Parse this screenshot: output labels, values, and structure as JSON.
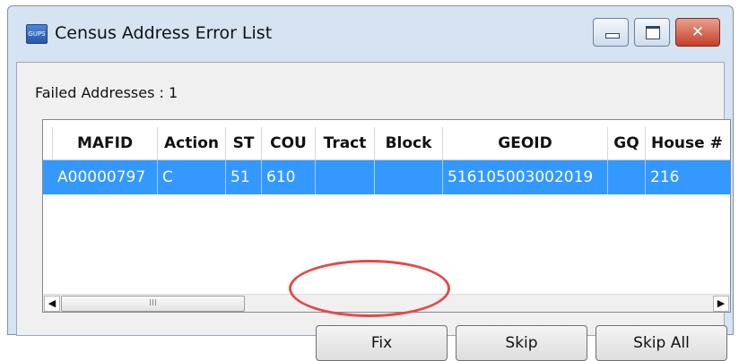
{
  "window": {
    "title": "Census Address Error List",
    "app_icon_text": "GUPS",
    "controls": {
      "minimize": "minimize",
      "maximize": "maximize",
      "close": "✕"
    }
  },
  "summary": {
    "failed_label": "Failed Addresses : 1"
  },
  "table": {
    "columns": [
      "MAFID",
      "Action",
      "ST",
      "COU",
      "Tract",
      "Block",
      "GEOID",
      "GQ",
      "House #"
    ],
    "rows": [
      [
        "A00000797",
        "C",
        "51",
        "610",
        "",
        "",
        "516105003002019",
        "",
        "216"
      ]
    ],
    "selected_row": 0,
    "selection_color": "#3399ff"
  },
  "scrollbar": {
    "left_arrow": "◀",
    "right_arrow": "▶",
    "grip": "III"
  },
  "buttons": {
    "fix": "Fix",
    "skip": "Skip",
    "skip_all": "Skip All"
  },
  "annotation": {
    "highlight_color": "#e34a4a",
    "target": "Fix"
  }
}
